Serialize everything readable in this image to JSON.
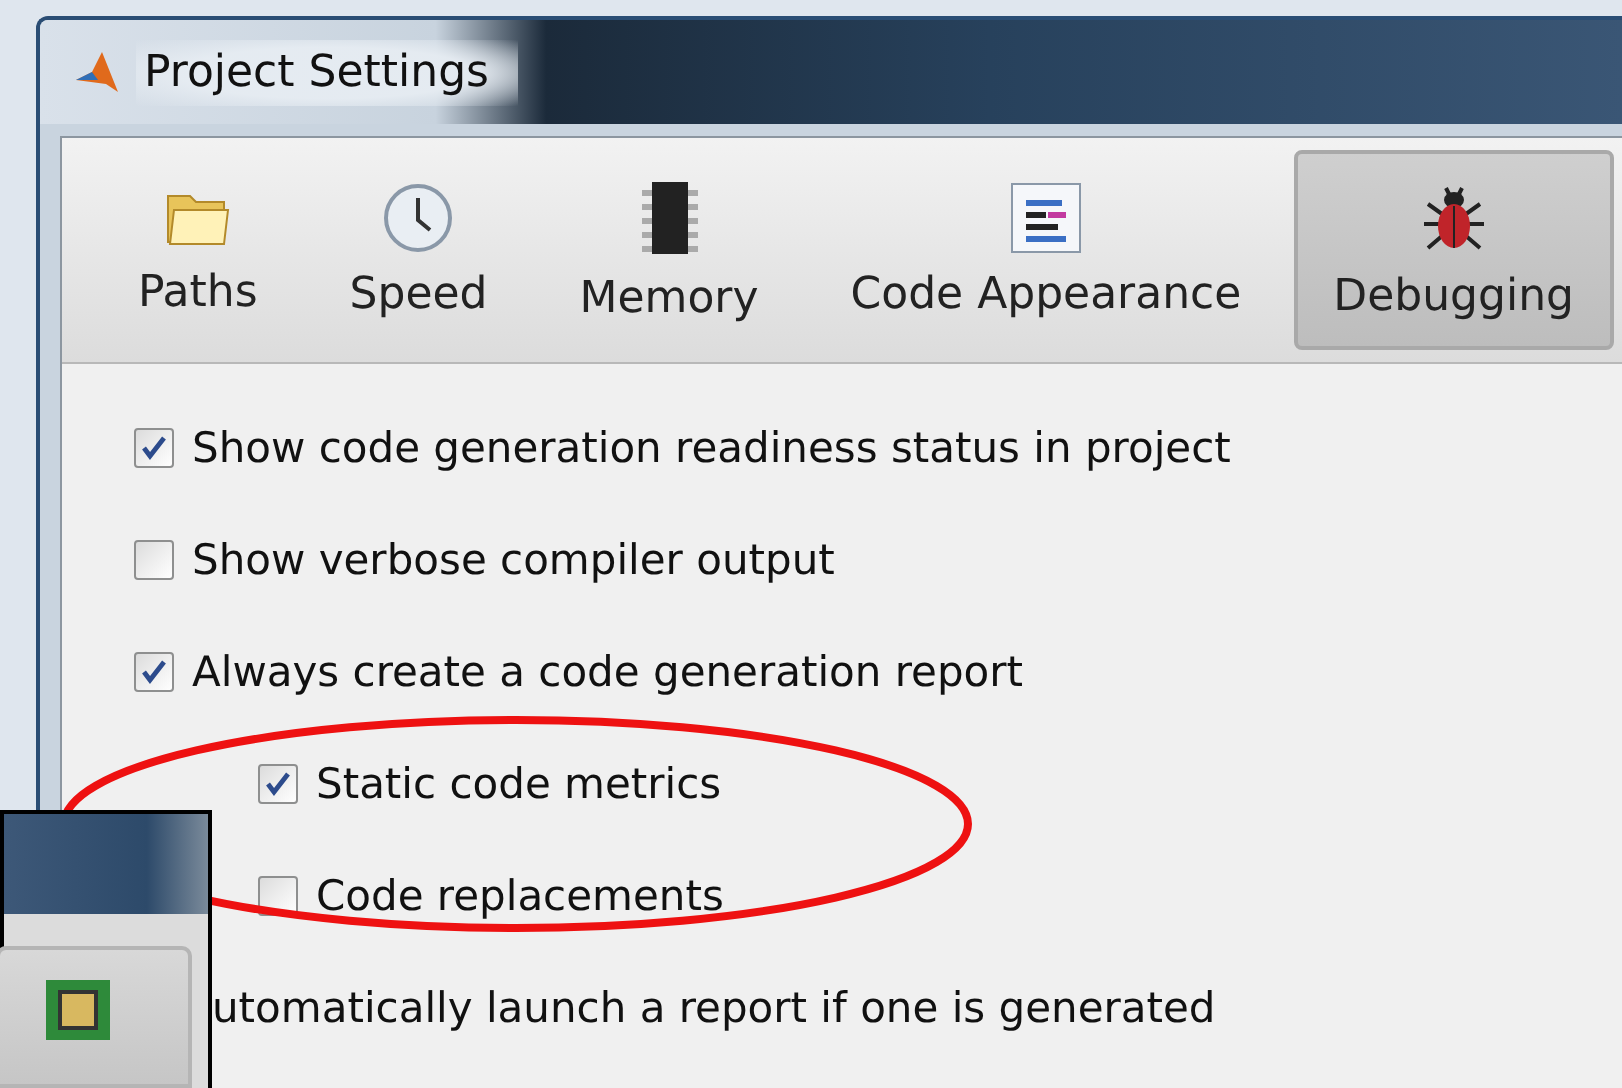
{
  "window": {
    "title": "Project Settings"
  },
  "tabs": [
    {
      "label": "Paths",
      "kind": "folder",
      "selected": false
    },
    {
      "label": "Speed",
      "kind": "clock",
      "selected": false
    },
    {
      "label": "Memory",
      "kind": "chip",
      "selected": false
    },
    {
      "label": "Code Appearance",
      "kind": "code",
      "selected": false
    },
    {
      "label": "Debugging",
      "kind": "bug",
      "selected": true
    }
  ],
  "options": [
    {
      "label": "Show code generation readiness status in project",
      "checked": true
    },
    {
      "label": "Show verbose compiler output",
      "checked": false
    },
    {
      "label": "Always create a code generation report",
      "checked": true,
      "children": [
        {
          "label": "Static code metrics",
          "checked": true
        },
        {
          "label": "Code replacements",
          "checked": false
        }
      ]
    },
    {
      "label": "utomatically launch a report if one is generated"
    }
  ]
}
